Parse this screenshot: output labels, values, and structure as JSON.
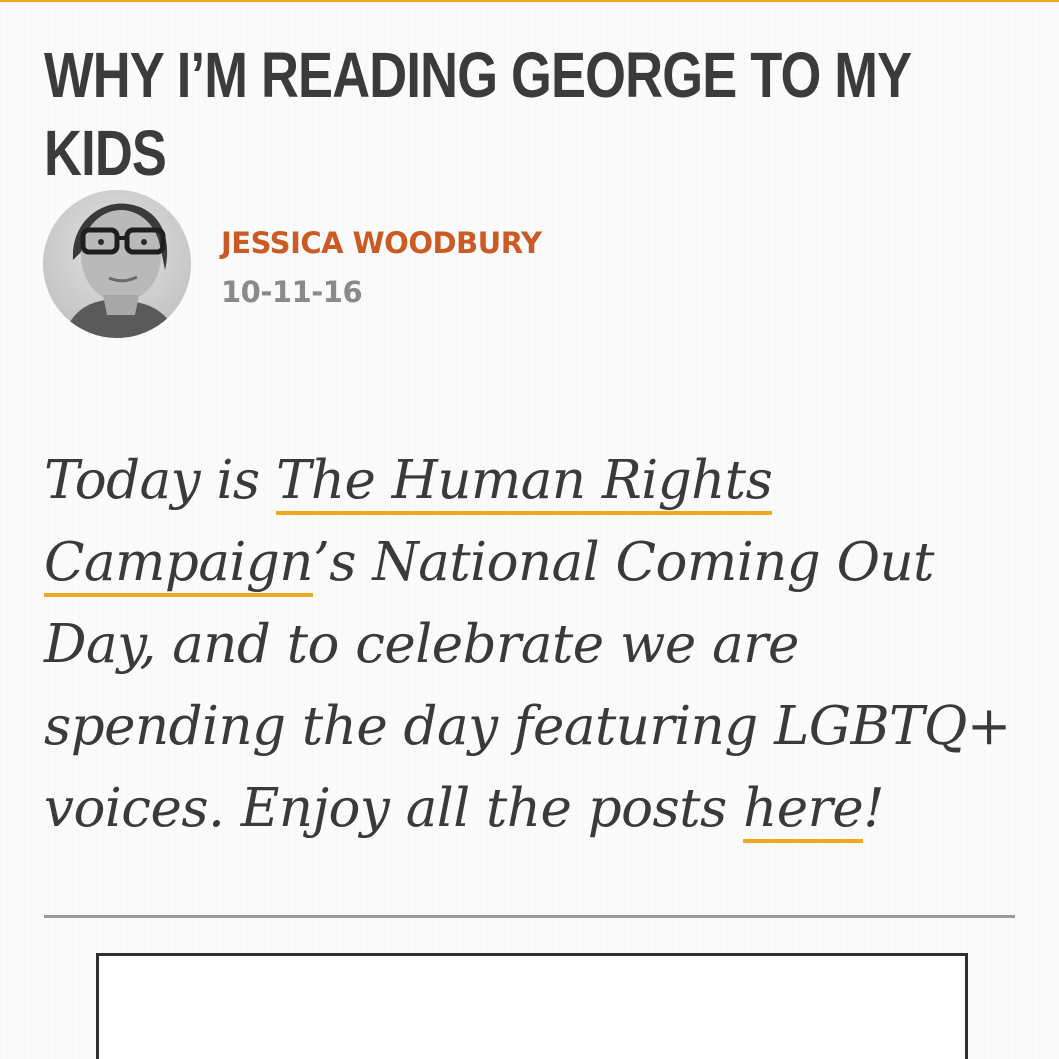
{
  "accent_color": "#f0a81e",
  "author_color": "#cc5a24",
  "article": {
    "title": "WHY I’M READING GEORGE TO MY KIDS",
    "author": "JESSICA WOODBURY",
    "date": "10-11-16",
    "intro": {
      "part1": "Today is ",
      "link1": "The Human Rights Campaign",
      "part2": "’s National Coming Out Day, and to celebrate we are spending the day featuring LGBTQ+ voices. Enjoy all the posts ",
      "link2": "here",
      "part3": "!"
    }
  },
  "icons": {
    "avatar": "author-avatar-photo"
  }
}
